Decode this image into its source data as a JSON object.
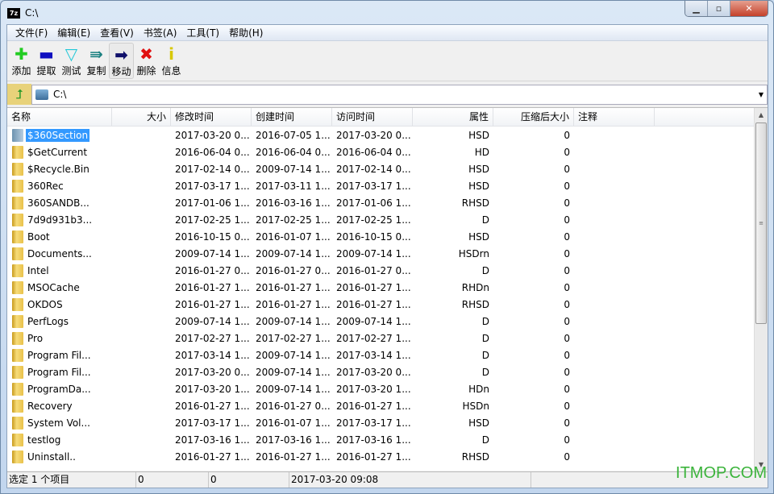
{
  "window": {
    "title": "C:\\",
    "logo": "7z"
  },
  "menu": [
    "文件(F)",
    "编辑(E)",
    "查看(V)",
    "书签(A)",
    "工具(T)",
    "帮助(H)"
  ],
  "toolbar": [
    {
      "label": "添加",
      "icon": "plus-icon",
      "color": "#22cc22",
      "glyph": "✚"
    },
    {
      "label": "提取",
      "icon": "minus-icon",
      "color": "#1010c0",
      "glyph": "▬"
    },
    {
      "label": "测试",
      "icon": "check-chevron-icon",
      "color": "#22c8d8",
      "glyph": "▽"
    },
    {
      "label": "复制",
      "icon": "copy-arrow-icon",
      "color": "#1a8080",
      "glyph": "⇛"
    },
    {
      "label": "移动",
      "icon": "move-arrow-icon",
      "color": "#10106a",
      "glyph": "➡"
    },
    {
      "label": "删除",
      "icon": "delete-x-icon",
      "color": "#e01010",
      "glyph": "✖"
    },
    {
      "label": "信息",
      "icon": "info-icon",
      "color": "#d8c800",
      "glyph": "i"
    }
  ],
  "address": {
    "path": "C:\\"
  },
  "columns": [
    "名称",
    "大小",
    "修改时间",
    "创建时间",
    "访问时间",
    "属性",
    "压缩后大小",
    "注释"
  ],
  "rows": [
    [
      "$360Section",
      "",
      "2017-03-20 0...",
      "2016-07-05 1...",
      "2017-03-20 0...",
      "HSD",
      "0",
      ""
    ],
    [
      "$GetCurrent",
      "",
      "2016-06-04 0...",
      "2016-06-04 0...",
      "2016-06-04 0...",
      "HD",
      "0",
      ""
    ],
    [
      "$Recycle.Bin",
      "",
      "2017-02-14 0...",
      "2009-07-14 1...",
      "2017-02-14 0...",
      "HSD",
      "0",
      ""
    ],
    [
      "360Rec",
      "",
      "2017-03-17 1...",
      "2017-03-11 1...",
      "2017-03-17 1...",
      "HSD",
      "0",
      ""
    ],
    [
      "360SANDB...",
      "",
      "2017-01-06 1...",
      "2016-03-16 1...",
      "2017-01-06 1...",
      "RHSD",
      "0",
      ""
    ],
    [
      "7d9d931b3...",
      "",
      "2017-02-25 1...",
      "2017-02-25 1...",
      "2017-02-25 1...",
      "D",
      "0",
      ""
    ],
    [
      "Boot",
      "",
      "2016-10-15 0...",
      "2016-01-07 1...",
      "2016-10-15 0...",
      "HSD",
      "0",
      ""
    ],
    [
      "Documents...",
      "",
      "2009-07-14 1...",
      "2009-07-14 1...",
      "2009-07-14 1...",
      "HSDrn",
      "0",
      ""
    ],
    [
      "Intel",
      "",
      "2016-01-27 0...",
      "2016-01-27 0...",
      "2016-01-27 0...",
      "D",
      "0",
      ""
    ],
    [
      "MSOCache",
      "",
      "2016-01-27 1...",
      "2016-01-27 1...",
      "2016-01-27 1...",
      "RHDn",
      "0",
      ""
    ],
    [
      "OKDOS",
      "",
      "2016-01-27 1...",
      "2016-01-27 1...",
      "2016-01-27 1...",
      "RHSD",
      "0",
      ""
    ],
    [
      "PerfLogs",
      "",
      "2009-07-14 1...",
      "2009-07-14 1...",
      "2009-07-14 1...",
      "D",
      "0",
      ""
    ],
    [
      "Pro",
      "",
      "2017-02-27 1...",
      "2017-02-27 1...",
      "2017-02-27 1...",
      "D",
      "0",
      ""
    ],
    [
      "Program Fil...",
      "",
      "2017-03-14 1...",
      "2009-07-14 1...",
      "2017-03-14 1...",
      "D",
      "0",
      ""
    ],
    [
      "Program Fil...",
      "",
      "2017-03-20 0...",
      "2009-07-14 1...",
      "2017-03-20 0...",
      "D",
      "0",
      ""
    ],
    [
      "ProgramDa...",
      "",
      "2017-03-20 1...",
      "2009-07-14 1...",
      "2017-03-20 1...",
      "HDn",
      "0",
      ""
    ],
    [
      "Recovery",
      "",
      "2016-01-27 1...",
      "2016-01-27 0...",
      "2016-01-27 1...",
      "HSDn",
      "0",
      ""
    ],
    [
      "System Vol...",
      "",
      "2017-03-17 1...",
      "2016-01-07 1...",
      "2017-03-17 1...",
      "HSD",
      "0",
      ""
    ],
    [
      "testlog",
      "",
      "2017-03-16 1...",
      "2017-03-16 1...",
      "2017-03-16 1...",
      "D",
      "0",
      ""
    ],
    [
      "Uninstall..",
      "",
      "2016-01-27 1...",
      "2016-01-27 1...",
      "2016-01-27 1...",
      "RHSD",
      "0",
      ""
    ]
  ],
  "selected_row": 0,
  "status": [
    "选定 1 个项目",
    "0",
    "0",
    "2017-03-20 09:08"
  ],
  "watermark": "ITMOP.COM"
}
